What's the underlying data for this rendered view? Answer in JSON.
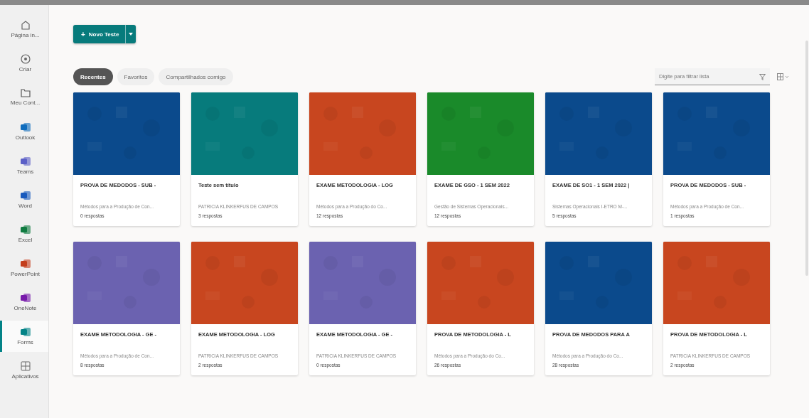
{
  "sidebar": {
    "items": [
      {
        "label": "Página in...",
        "kind": "home",
        "selected": false
      },
      {
        "label": "Criar",
        "kind": "create",
        "selected": false
      },
      {
        "label": "Meu Cont...",
        "kind": "folder",
        "selected": false
      },
      {
        "label": "Outlook",
        "kind": "app",
        "color": "#0f6cbd",
        "selected": false
      },
      {
        "label": "Teams",
        "kind": "app",
        "color": "#5b5fc7",
        "selected": false
      },
      {
        "label": "Word",
        "kind": "app",
        "color": "#185abd",
        "selected": false
      },
      {
        "label": "Excel",
        "kind": "app",
        "color": "#107c41",
        "selected": false
      },
      {
        "label": "PowerPoint",
        "kind": "app",
        "color": "#c43e1c",
        "selected": false
      },
      {
        "label": "OneNote",
        "kind": "app",
        "color": "#7719aa",
        "selected": false
      },
      {
        "label": "Forms",
        "kind": "app",
        "color": "#038387",
        "selected": true
      },
      {
        "label": "Aplicativos",
        "kind": "apps",
        "selected": false
      }
    ]
  },
  "new_button": {
    "label": "Novo Teste",
    "icon": "+"
  },
  "tabs": [
    {
      "label": "Recentes",
      "selected": true
    },
    {
      "label": "Favoritos",
      "selected": false
    },
    {
      "label": "Compartilhados comigo",
      "selected": false
    }
  ],
  "filter": {
    "placeholder": "Digite para filtrar lista"
  },
  "cards": [
    {
      "title": "PROVA DE MEDODOS - SUB -",
      "subtitle": "Métodos para a Produção de Con...",
      "responses": "0 respostas",
      "color": "#0b4a8c"
    },
    {
      "title": "Teste sem título",
      "subtitle": "PATRICIA KLINKERFUS DE CAMPOS",
      "responses": "3 respostas",
      "color": "#077b7c"
    },
    {
      "title": "EXAME METODOLOGIA - LOG",
      "subtitle": "Métodos para a Produção do Co...",
      "responses": "12 respostas",
      "color": "#c8461f"
    },
    {
      "title": "EXAME DE GSO - 1 SEM 2022",
      "subtitle": "Gestão de Sistemas Operacionais...",
      "responses": "12 respostas",
      "color": "#1a8a2a"
    },
    {
      "title": "EXAME DE SO1 - 1 SEM 2022 |",
      "subtitle": "Sistemas Operacionais I-ETRO M-...",
      "responses": "5 respostas",
      "color": "#0b4a8c"
    },
    {
      "title": "PROVA DE MEDODOS - SUB -",
      "subtitle": "Métodos para a Produção de Con...",
      "responses": "1 respostas",
      "color": "#0b4a8c"
    },
    {
      "title": "EXAME METODOLOGIA - GE -",
      "subtitle": "Métodos para a Produção de Con...",
      "responses": "8 respostas",
      "color": "#6b62b0"
    },
    {
      "title": "EXAME METODOLOGIA - LOG",
      "subtitle": "PATRICIA KLINKERFUS DE CAMPOS",
      "responses": "2 respostas",
      "color": "#c8461f"
    },
    {
      "title": "EXAME METODOLOGIA - GE -",
      "subtitle": "PATRICIA KLINKERFUS DE CAMPOS",
      "responses": "0 respostas",
      "color": "#6b62b0"
    },
    {
      "title": "PROVA DE METODOLOGIA - L",
      "subtitle": "Métodos para a Produção do Co...",
      "responses": "26 respostas",
      "color": "#c8461f"
    },
    {
      "title": "PROVA DE MEDODOS PARA A",
      "subtitle": "Métodos para a Produção do Co...",
      "responses": "28 respostas",
      "color": "#0b4a8c"
    },
    {
      "title": "PROVA DE METODOLOGIA - L",
      "subtitle": "PATRICIA KLINKERFUS DE CAMPOS",
      "responses": "2 respostas",
      "color": "#c8461f"
    }
  ]
}
